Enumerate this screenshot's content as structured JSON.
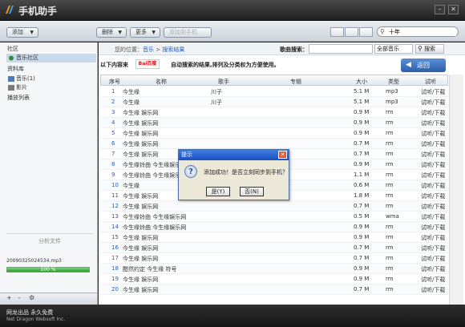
{
  "app": {
    "title": "手机助手",
    "colors": {
      "titlebar": "#2b2b2b",
      "accent": "#2c5eab",
      "progress": "#2e9b2e"
    }
  },
  "toolbar": {
    "add_label": "添加",
    "delete_label": "删除",
    "more_label": "更多",
    "disabled_label": "添加到手机",
    "search_value": "十年"
  },
  "sidebar": {
    "community_title": "社区",
    "music_community": "音乐社区",
    "library_title": "资料库",
    "music_item": "音乐(1)",
    "video_item": "影片",
    "playlist_title": "播放列表",
    "analysis_title": "分析文件",
    "analysis_file": "20090325024534.mp3",
    "progress_text": "100 %",
    "progress_value": 1.0
  },
  "crumb": {
    "location_label": "您的位置：",
    "level1": "音乐",
    "separator": " > ",
    "level2": "搜索结果",
    "search_label": "歌曲搜索：",
    "search_value": "",
    "category": "全部音乐",
    "search_button": "搜索"
  },
  "content": {
    "lead": "以下内容来",
    "baidu": "Bai百度",
    "description": "自动搜索的结果,排列及分类权为方便使用。",
    "back_label": "返回"
  },
  "table": {
    "headers": [
      "序号",
      "名称",
      "歌手",
      "专辑",
      "大小",
      "类型",
      "试听"
    ],
    "rows": [
      [
        "1",
        "今生缘",
        "川子",
        "",
        "5.1 M",
        "mp3",
        "试听/下载"
      ],
      [
        "2",
        "今生缘",
        "川子",
        "",
        "5.1 M",
        "mp3",
        "试听/下载"
      ],
      [
        "3",
        "今生缘 娱乐网",
        "",
        "",
        "0.9 M",
        "rm",
        "试听/下载"
      ],
      [
        "4",
        "今生缘 娱乐网",
        "",
        "",
        "0.9 M",
        "rm",
        "试听/下载"
      ],
      [
        "5",
        "今生缘 娱乐网",
        "",
        "",
        "0.9 M",
        "rm",
        "试听/下载"
      ],
      [
        "6",
        "今生缘 娱乐网",
        "",
        "",
        "0.7 M",
        "rm",
        "试听/下载"
      ],
      [
        "7",
        "今生缘 娱乐网",
        "",
        "",
        "0.7 M",
        "rm",
        "试听/下载"
      ],
      [
        "8",
        "今生缘铃曲 今生缘娱乐网",
        "",
        "",
        "0.9 M",
        "rm",
        "试听/下载"
      ],
      [
        "9",
        "今生缘铃曲 今生缘娱乐网",
        "",
        "",
        "1.1 M",
        "rm",
        "试听/下载"
      ],
      [
        "10",
        "今生缘",
        "",
        "",
        "0.6 M",
        "rm",
        "试听/下载"
      ],
      [
        "11",
        "今生缘 娱乐网",
        "",
        "",
        "1.8 M",
        "rm",
        "试听/下载"
      ],
      [
        "12",
        "今生缘 娱乐网",
        "",
        "",
        "0.7 M",
        "rm",
        "试听/下载"
      ],
      [
        "13",
        "今生缘铃曲 今生缘娱乐网",
        "",
        "",
        "0.5 M",
        "wma",
        "试听/下载"
      ],
      [
        "14",
        "今生缘铃曲 今生缘娱乐网",
        "",
        "",
        "0.9 M",
        "rm",
        "试听/下载"
      ],
      [
        "15",
        "今生缘 娱乐网",
        "",
        "",
        "0.9 M",
        "rm",
        "试听/下载"
      ],
      [
        "16",
        "今生缘 娱乐网",
        "",
        "",
        "0.7 M",
        "rm",
        "试听/下载"
      ],
      [
        "17",
        "今生缘 娱乐网",
        "",
        "",
        "0.7 M",
        "rm",
        "试听/下载"
      ],
      [
        "18",
        "酣然约定 今生缘 符号",
        "",
        "",
        "0.9 M",
        "rm",
        "试听/下载"
      ],
      [
        "19",
        "今生缘 娱乐网",
        "",
        "",
        "0.9 M",
        "rm",
        "试听/下载"
      ],
      [
        "20",
        "今生缘 娱乐网",
        "",
        "",
        "0.7 M",
        "rm",
        "试听/下载"
      ]
    ]
  },
  "dialog": {
    "title": "提示",
    "message": "添加成功！是否立刻同步到手机？",
    "yes_label": "是(Y)",
    "no_label": "否(N)"
  },
  "status": {
    "line1": "网龙出品 永久免费",
    "line2": "Net Dragon Websoft Inc."
  }
}
